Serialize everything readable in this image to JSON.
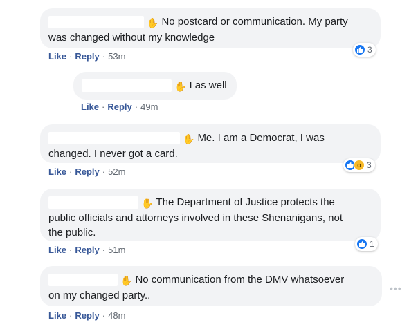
{
  "icons": {
    "hand": "raised-hand-icon",
    "like": "like-thumb-icon",
    "wow": "wow-face-icon",
    "more": "more-options-icon"
  },
  "colors": {
    "bubble": "#f2f3f5",
    "link": "#385898",
    "meta": "#606770",
    "like_blue": "#1877f2",
    "wow_yellow": "#f7b928"
  },
  "comments": [
    {
      "text_line1": "No postcard or communication. My party",
      "text_line2": "was changed without my knowledge",
      "text_line3": "",
      "like": "Like",
      "reply": "Reply",
      "time": "53m",
      "reaction_count": "3"
    },
    {
      "text_line1": "I as well",
      "text_line2": "",
      "text_line3": "",
      "like": "Like",
      "reply": "Reply",
      "time": "49m",
      "reaction_count": ""
    },
    {
      "text_line1": "Me. I am a Democrat, I was",
      "text_line2": "changed. I never got a card.",
      "text_line3": "",
      "like": "Like",
      "reply": "Reply",
      "time": "52m",
      "reaction_count": "3"
    },
    {
      "text_line1": "The Department of Justice protects the",
      "text_line2": "public officials and attorneys involved in these Shenanigans, not",
      "text_line3": "the public.",
      "like": "Like",
      "reply": "Reply",
      "time": "51m",
      "reaction_count": "1"
    },
    {
      "text_line1": "No communication from the DMV whatsoever",
      "text_line2": "on my changed party..",
      "text_line3": "",
      "like": "Like",
      "reply": "Reply",
      "time": "48m",
      "reaction_count": ""
    }
  ],
  "separator": "·"
}
